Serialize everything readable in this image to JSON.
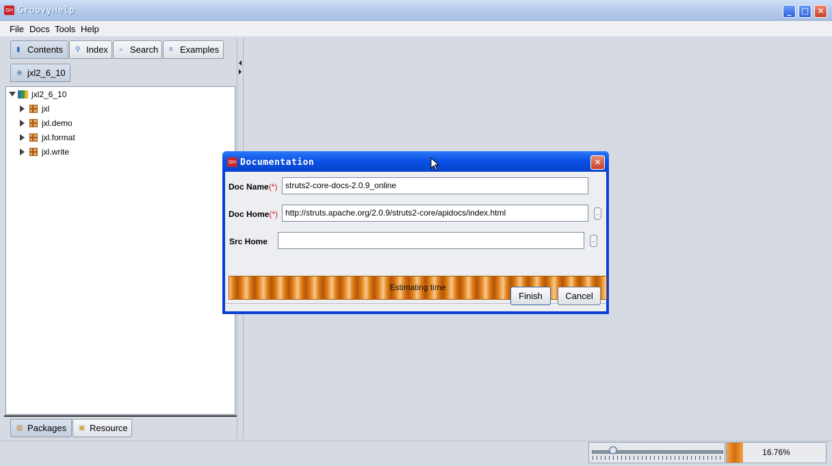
{
  "window": {
    "title": "GroovyHelp",
    "icon_text": "GH",
    "minimize": "_",
    "maximize": "□",
    "close": "✕"
  },
  "menu": [
    "File",
    "Docs",
    "Tools",
    "Help"
  ],
  "top_tabs": [
    {
      "label": "Contents",
      "icon": "book-icon",
      "selected": true
    },
    {
      "label": "Index",
      "icon": "magnifier-icon",
      "selected": false
    },
    {
      "label": "Search",
      "icon": "search-doc-icon",
      "selected": false
    },
    {
      "label": "Examples",
      "icon": "examples-icon",
      "selected": false
    }
  ],
  "doc_tab": {
    "label": "jxl2_6_10",
    "icon": "cd-icon"
  },
  "tree": {
    "root": "jxl2_6_10",
    "children": [
      "jxl",
      "jxl.demo",
      "jxl.format",
      "jxl.write"
    ]
  },
  "bottom_tabs": [
    {
      "label": "Packages",
      "icon": "packages-icon",
      "selected": true
    },
    {
      "label": "Resource",
      "icon": "resource-icon",
      "selected": false
    }
  ],
  "status": {
    "progress_percent": 16.76,
    "progress_text": "16.76%",
    "slider_value": 0.14
  },
  "dialog": {
    "title": "Documentation",
    "icon_text": "GH",
    "close": "✕",
    "doc_name_label": "Doc Name",
    "doc_home_label": "Doc Home",
    "src_home_label": "Src Home",
    "required_mark": "(*)",
    "doc_name_value": "struts2-core-docs-2.0.9_online",
    "doc_home_value": "http://struts.apache.org/2.0.9/struts2-core/apidocs/index.html",
    "src_home_value": "",
    "browse_label": "...",
    "progress_text": "Estimating time",
    "finish_label": "Finish",
    "cancel_label": "Cancel"
  },
  "colors": {
    "accent": "#0b52e6",
    "progress": "#e07c12"
  }
}
